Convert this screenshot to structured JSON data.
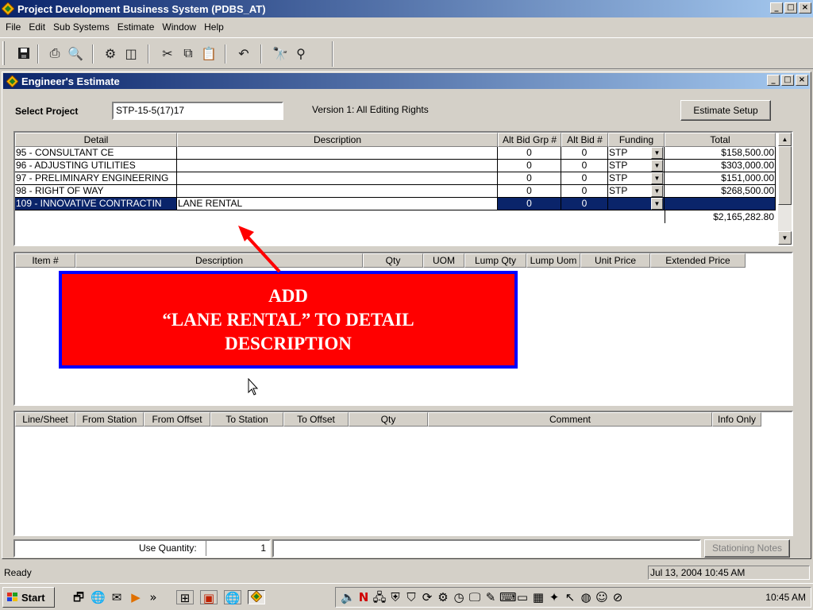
{
  "app": {
    "title": "Project Development Business System (PDBS_AT)",
    "window_buttons": [
      "_",
      "□",
      "×"
    ]
  },
  "menu": [
    "File",
    "Edit",
    "Sub Systems",
    "Estimate",
    "Window",
    "Help"
  ],
  "toolbar": {
    "icons": [
      "save-icon",
      "print-icon",
      "print-preview-icon",
      "tools-icon",
      "layout-icon",
      "cut-icon",
      "copy-icon",
      "paste-icon",
      "undo-icon",
      "find-icon",
      "find-replace-icon"
    ]
  },
  "child_window": {
    "title": "Engineer's Estimate",
    "select_project_label": "Select Project",
    "project_value": "STP-15-5(17)17",
    "version_text": "Version 1: All Editing Rights",
    "estimate_setup_button": "Estimate Setup"
  },
  "detail_grid": {
    "headers": [
      "Detail",
      "Description",
      "Alt Bid Grp #",
      "Alt Bid #",
      "Funding",
      "Total"
    ],
    "rows": [
      {
        "detail": "95 - CONSULTANT CE",
        "description": "",
        "alt_grp": "0",
        "alt_bid": "0",
        "funding": "STP",
        "total": "$158,500.00"
      },
      {
        "detail": "96 - ADJUSTING UTILITIES",
        "description": "",
        "alt_grp": "0",
        "alt_bid": "0",
        "funding": "STP",
        "total": "$303,000.00"
      },
      {
        "detail": "97 - PRELIMINARY ENGINEERING",
        "description": "",
        "alt_grp": "0",
        "alt_bid": "0",
        "funding": "STP",
        "total": "$151,000.00"
      },
      {
        "detail": "98 - RIGHT OF WAY",
        "description": "",
        "alt_grp": "0",
        "alt_bid": "0",
        "funding": "STP",
        "total": "$268,500.00"
      },
      {
        "detail": "109 - INNOVATIVE CONTRACTIN",
        "description": "LANE RENTAL",
        "alt_grp": "0",
        "alt_bid": "0",
        "funding": "",
        "total": ""
      }
    ],
    "grand_total": "$2,165,282.80",
    "selected_row": 4
  },
  "item_grid": {
    "headers": [
      "Item #",
      "Description",
      "Qty",
      "UOM",
      "Lump Qty",
      "Lump Uom",
      "Unit Price",
      "Extended Price"
    ]
  },
  "callout": {
    "line1": "ADD",
    "line2": "“LANE RENTAL”  TO DETAIL",
    "line3": "DESCRIPTION",
    "background": "#ff0000",
    "border": "#0000ff"
  },
  "station_grid": {
    "headers": [
      "Line/Sheet",
      "From Station",
      "From Offset",
      "To Station",
      "To Offset",
      "Qty",
      "Comment",
      "Info Only"
    ]
  },
  "footer": {
    "use_quantity_label": "Use Quantity:",
    "use_quantity_value": "1",
    "stationing_notes_button": "Stationing Notes"
  },
  "status": {
    "text": "Ready",
    "datetime": "Jul 13, 2004 10:45 AM"
  },
  "taskbar": {
    "start_label": "Start",
    "chevron": "»",
    "clock": "10:45 AM"
  },
  "colors": {
    "titlebar_start": "#0a246a",
    "titlebar_end": "#a6caf0",
    "selection": "#0a246a",
    "face": "#d4d0c8",
    "arrow": "#ff0000"
  }
}
